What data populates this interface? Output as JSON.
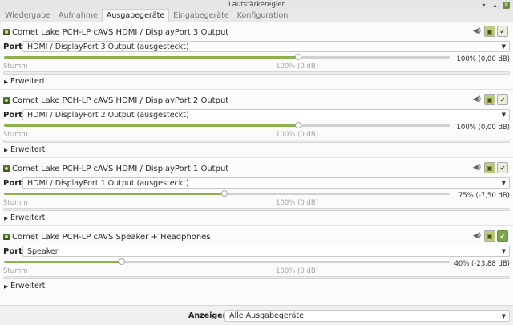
{
  "window": {
    "title": "Lautstärkeregler",
    "controls": {
      "minimize": "▾",
      "maximize": "▴",
      "close": "✕"
    }
  },
  "tabs": [
    {
      "label": "Wiedergabe"
    },
    {
      "label": "Aufnahme"
    },
    {
      "label": "Ausgabegeräte",
      "active": true
    },
    {
      "label": "Eingabegeräte"
    },
    {
      "label": "Konfiguration"
    }
  ],
  "common": {
    "port_label": "Port:",
    "scale_min": "Stumm",
    "scale_mid": "100% (0 dB)",
    "advanced": "Erweitert",
    "mute_icon": "speaker-icon",
    "lock_icon": "lock-icon",
    "default_icon": "check-icon"
  },
  "devices": [
    {
      "name": "Comet Lake PCH-LP cAVS HDMI / DisplayPort 3 Output",
      "port": "HDMI / DisplayPort 3 Output (ausgesteckt)",
      "volume_fraction": 0.66,
      "volume_text": "100% (0,00 dB)",
      "is_default": false
    },
    {
      "name": "Comet Lake PCH-LP cAVS HDMI / DisplayPort 2 Output",
      "port": "HDMI / DisplayPort 2 Output (ausgesteckt)",
      "volume_fraction": 0.66,
      "volume_text": "100% (0,00 dB)",
      "is_default": false
    },
    {
      "name": "Comet Lake PCH-LP cAVS HDMI / DisplayPort 1 Output",
      "port": "HDMI / DisplayPort 1 Output (ausgesteckt)",
      "volume_fraction": 0.495,
      "volume_text": "75% (-7,50 dB)",
      "is_default": false
    },
    {
      "name": "Comet Lake PCH-LP cAVS Speaker + Headphones",
      "port": "Speaker",
      "volume_fraction": 0.264,
      "volume_text": "40% (-23,88 dB)",
      "is_default": true
    }
  ],
  "footer": {
    "show_label": "Anzeigen:",
    "show_value": "Alle Ausgabegeräte"
  },
  "colors": {
    "accent": "#8fb04f",
    "default_on": "#7ea64a"
  }
}
